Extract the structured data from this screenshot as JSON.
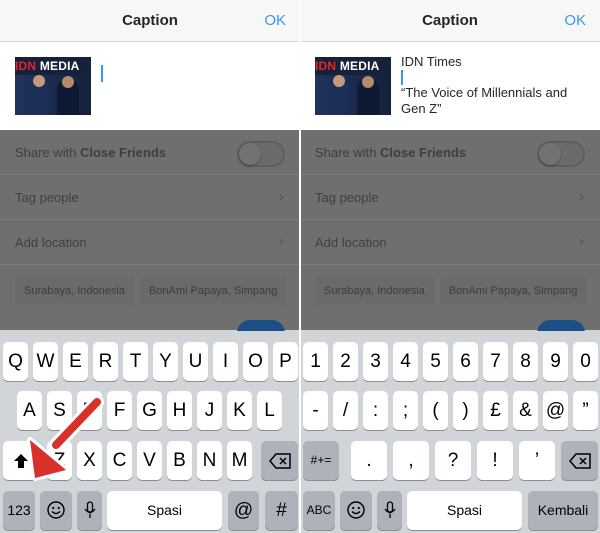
{
  "left": {
    "nav": {
      "title": "Caption",
      "ok": "OK"
    },
    "thumb_logo": {
      "red": "IDN",
      "white": " MEDIA"
    },
    "rows": [
      {
        "label": "Share with ",
        "bold": "Close Friends"
      },
      {
        "label": "Tag people"
      },
      {
        "label": "Add location"
      }
    ],
    "chips": [
      "Surabaya, Indonesia",
      "BonAmi Papaya, Simpang"
    ],
    "keyboard": {
      "row1": [
        "Q",
        "W",
        "E",
        "R",
        "T",
        "Y",
        "U",
        "I",
        "O",
        "P"
      ],
      "row2": [
        "A",
        "S",
        "D",
        "F",
        "G",
        "H",
        "J",
        "K",
        "L"
      ],
      "row3": [
        "Z",
        "X",
        "C",
        "V",
        "B",
        "N",
        "M"
      ],
      "num_label": "123",
      "space_label": "Spasi",
      "at_label": "@",
      "hash_label": "#"
    }
  },
  "right": {
    "nav": {
      "title": "Caption",
      "ok": "OK"
    },
    "caption_line1": "IDN Times",
    "caption_line2": "“The Voice of Millennials and Gen Z”",
    "rows": [
      {
        "label": "Share with ",
        "bold": "Close Friends"
      },
      {
        "label": "Tag people"
      },
      {
        "label": "Add location"
      }
    ],
    "chips": [
      "Surabaya, Indonesia",
      "BonAmi Papaya, Simpang"
    ],
    "keyboard": {
      "row1": [
        "1",
        "2",
        "3",
        "4",
        "5",
        "6",
        "7",
        "8",
        "9",
        "0"
      ],
      "row2": [
        "-",
        "/",
        ":",
        ";",
        "(",
        ")",
        "£",
        "&",
        "@",
        "”"
      ],
      "row3": [
        ".",
        ",",
        "?",
        "!",
        "’"
      ],
      "sym_label": "#+=",
      "abc_label": "ABC",
      "space_label": "Spasi",
      "return_label": "Kembali"
    }
  },
  "colors": {
    "accent": "#3897f0",
    "arrow": "#d9302c"
  }
}
